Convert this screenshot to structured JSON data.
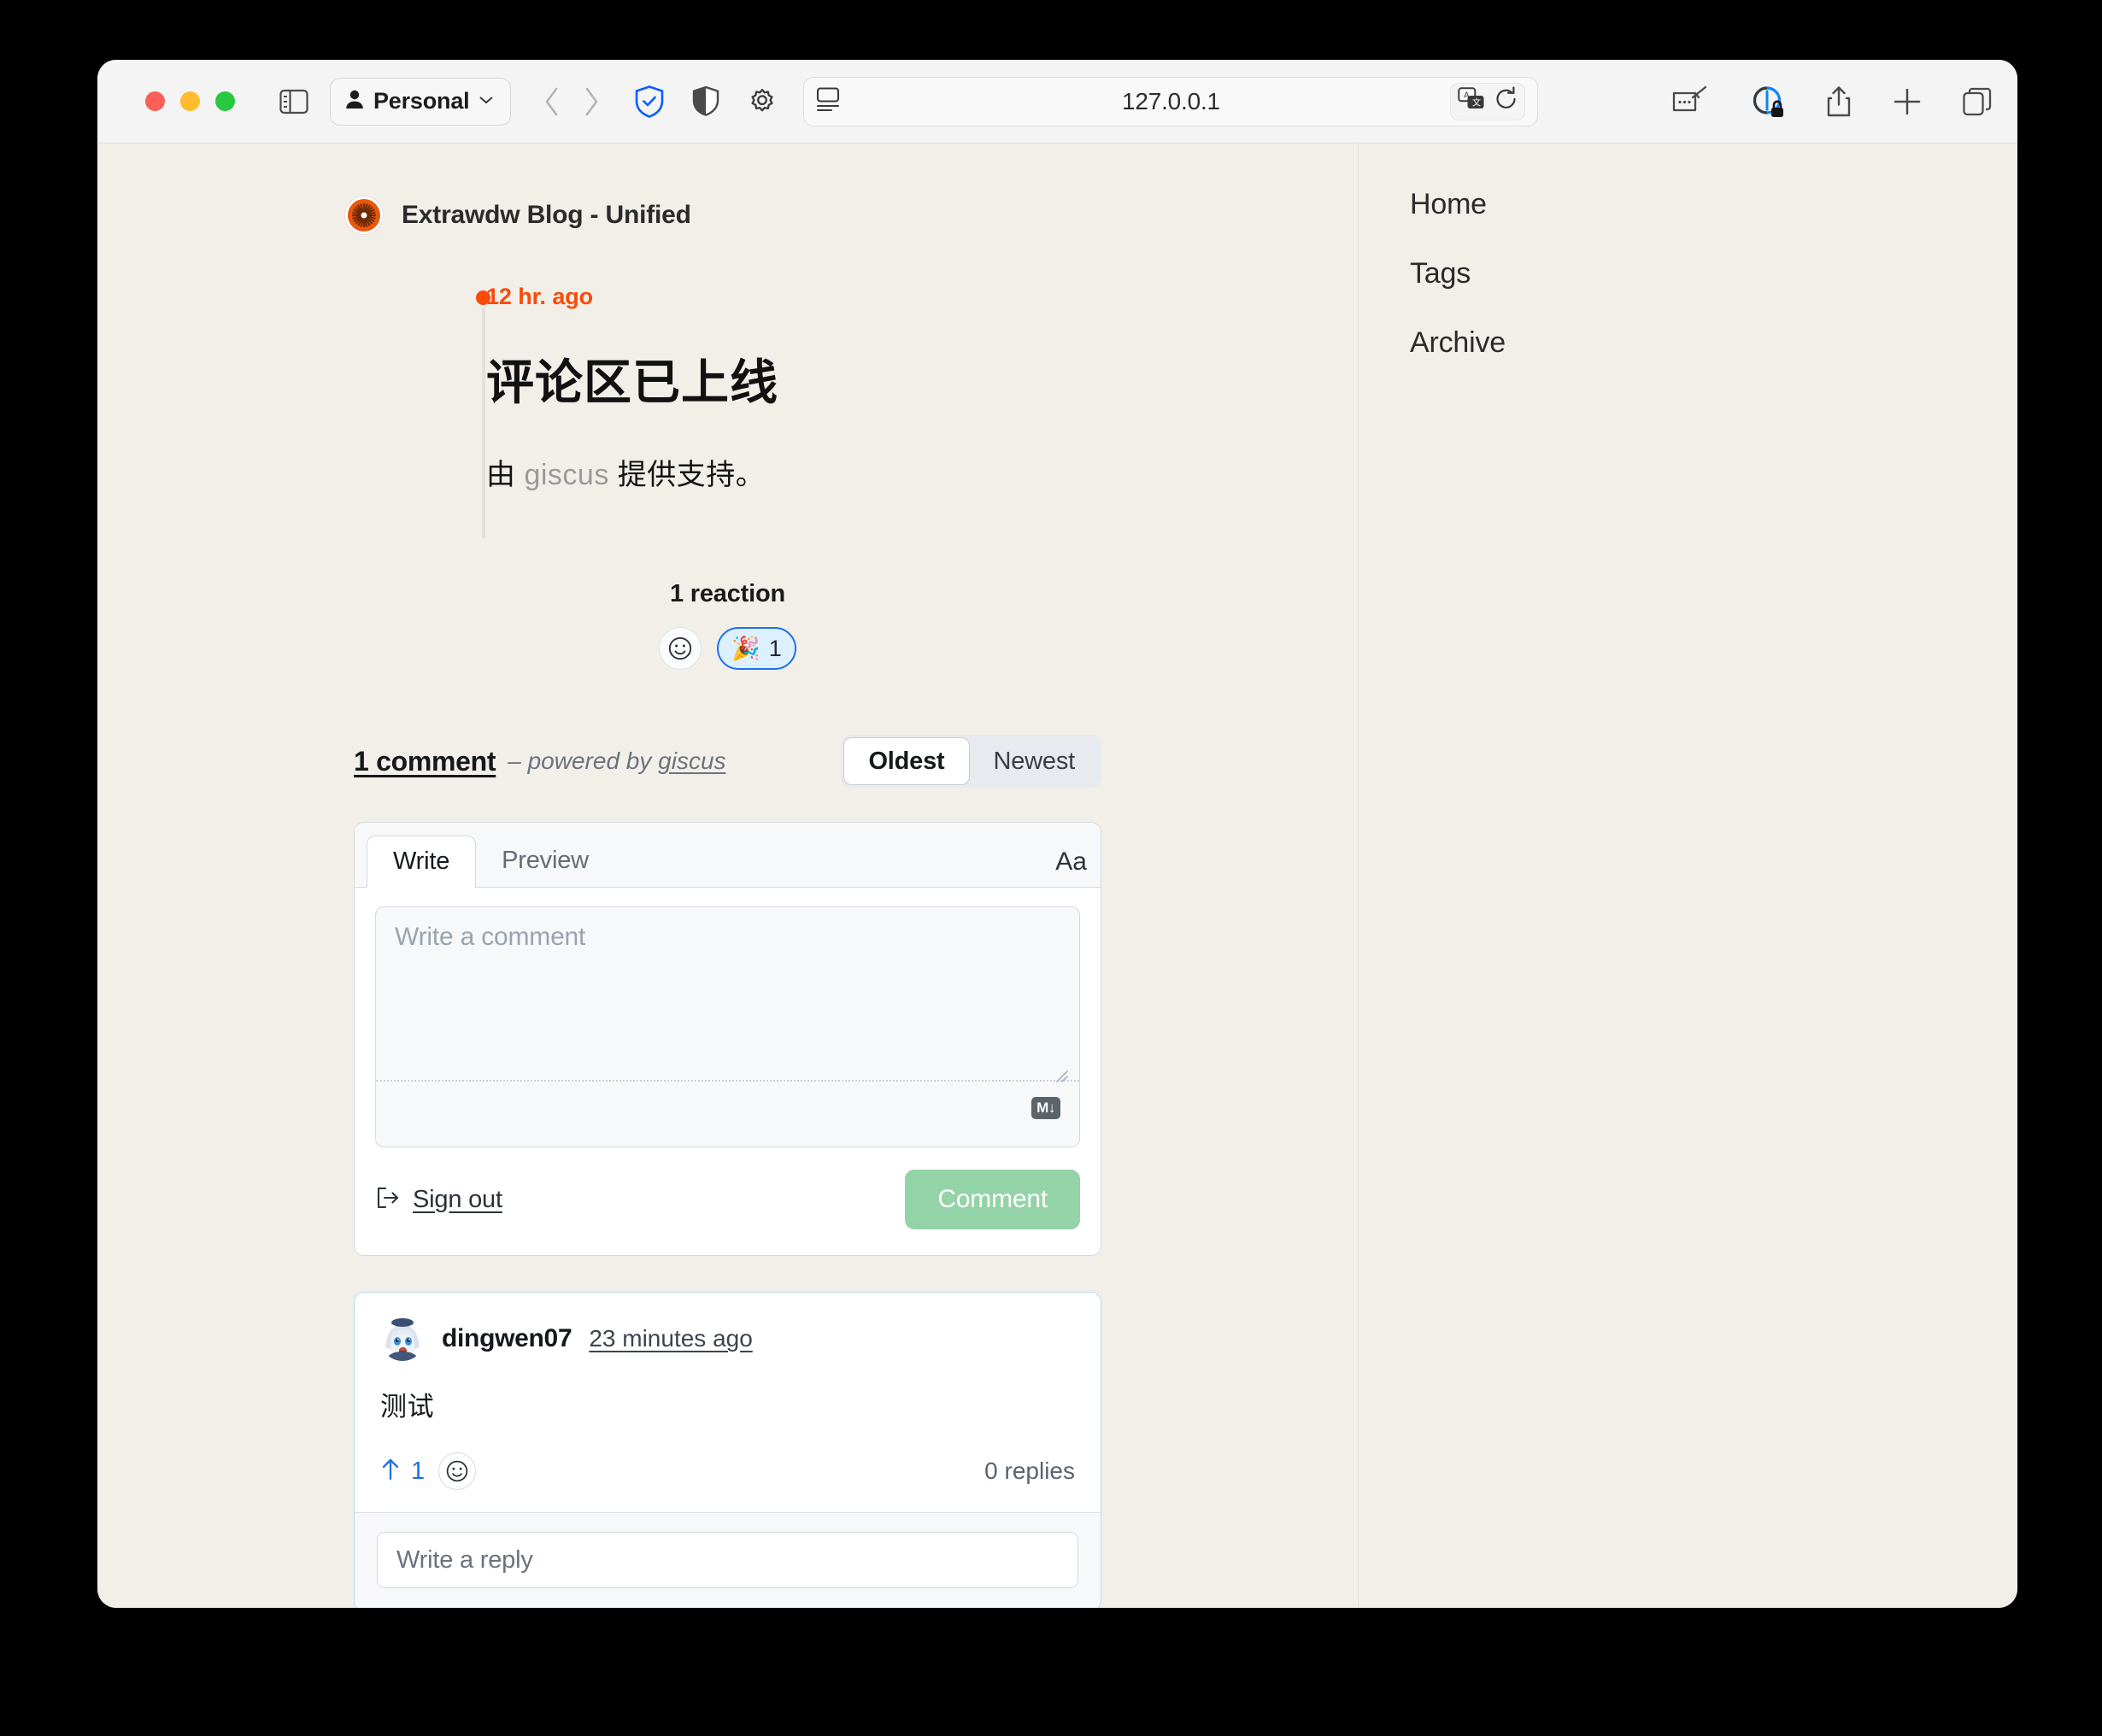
{
  "browser": {
    "profile_label": "Personal",
    "url": "127.0.0.1",
    "icons": {
      "sidebar": "sidebar-toggle-icon",
      "back": "back-arrow-icon",
      "forward": "forward-arrow-icon",
      "shield_check": "shield-check-icon",
      "privacy_shield": "privacy-shield-icon",
      "gear": "gear-icon",
      "reader": "reader-view-icon",
      "translate": "translate-icon",
      "reload": "reload-icon",
      "extension": "extension-icon",
      "privacy_report": "privacy-report-lock-icon",
      "share": "share-icon",
      "new_tab": "new-tab-plus-icon",
      "tab_overview": "tab-overview-icon"
    }
  },
  "site": {
    "blog_title": "Extrawdw Blog - Unified",
    "nav": [
      {
        "label": "Home"
      },
      {
        "label": "Tags"
      },
      {
        "label": "Archive"
      }
    ]
  },
  "post": {
    "ago": "12 hr. ago",
    "title": "评论区已上线",
    "body_prefix": "由 ",
    "body_link": "giscus",
    "body_suffix": " 提供支持。"
  },
  "reactions": {
    "title": "1 reaction",
    "add_label": "add-reaction",
    "items": [
      {
        "emoji": "🎉",
        "name": "party-popper",
        "count": "1",
        "selected": true
      }
    ]
  },
  "comments_header": {
    "count_label": "1 comment",
    "powered_dash": "– ",
    "powered_text": "powered by ",
    "powered_link": "giscus",
    "sort": {
      "oldest": "Oldest",
      "newest": "Newest",
      "selected": "Oldest"
    }
  },
  "composer": {
    "tabs": [
      {
        "label": "Write",
        "active": true
      },
      {
        "label": "Preview",
        "active": false
      }
    ],
    "font_button": "Aa",
    "placeholder": "Write a comment",
    "value": "",
    "markdown_badge": "M↓",
    "signout_label": "Sign out",
    "submit_label": "Comment"
  },
  "comment": {
    "author": "dingwen07",
    "time": "23 minutes ago",
    "body": "测试",
    "upvotes": "1",
    "replies_label": "0 replies",
    "reply_placeholder": "Write a reply"
  },
  "colors": {
    "page_bg": "#f2efe9",
    "accent_orange": "#fb4b09",
    "link_blue": "#1f6feb",
    "comment_green": "#94d3a7",
    "card_border_blue": "#b6d9f5"
  }
}
